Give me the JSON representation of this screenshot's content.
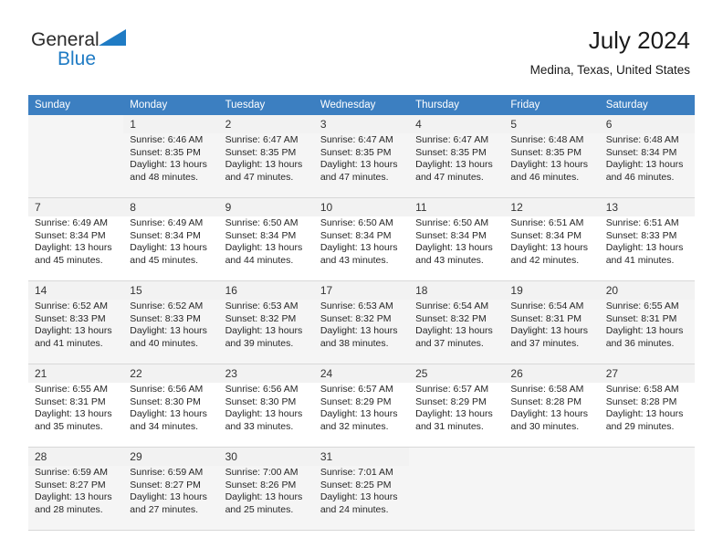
{
  "brand": {
    "name_part1": "General",
    "name_part2": "Blue",
    "color_dark": "#2b2b2b",
    "color_blue": "#1f7bc4"
  },
  "header": {
    "title": "July 2024",
    "subtitle": "Medina, Texas, United States"
  },
  "calendar": {
    "header_bg": "#3c7fc1",
    "weekdays": [
      "Sunday",
      "Monday",
      "Tuesday",
      "Wednesday",
      "Thursday",
      "Friday",
      "Saturday"
    ],
    "labels": {
      "sunrise": "Sunrise:",
      "sunset": "Sunset:",
      "daylight": "Daylight:"
    },
    "weeks": [
      {
        "shaded": true,
        "days": [
          {
            "num": "",
            "sunrise": "",
            "sunset": "",
            "daylight_line1": "",
            "daylight_line2": ""
          },
          {
            "num": "1",
            "sunrise": "Sunrise: 6:46 AM",
            "sunset": "Sunset: 8:35 PM",
            "daylight_line1": "Daylight: 13 hours",
            "daylight_line2": "and 48 minutes."
          },
          {
            "num": "2",
            "sunrise": "Sunrise: 6:47 AM",
            "sunset": "Sunset: 8:35 PM",
            "daylight_line1": "Daylight: 13 hours",
            "daylight_line2": "and 47 minutes."
          },
          {
            "num": "3",
            "sunrise": "Sunrise: 6:47 AM",
            "sunset": "Sunset: 8:35 PM",
            "daylight_line1": "Daylight: 13 hours",
            "daylight_line2": "and 47 minutes."
          },
          {
            "num": "4",
            "sunrise": "Sunrise: 6:47 AM",
            "sunset": "Sunset: 8:35 PM",
            "daylight_line1": "Daylight: 13 hours",
            "daylight_line2": "and 47 minutes."
          },
          {
            "num": "5",
            "sunrise": "Sunrise: 6:48 AM",
            "sunset": "Sunset: 8:35 PM",
            "daylight_line1": "Daylight: 13 hours",
            "daylight_line2": "and 46 minutes."
          },
          {
            "num": "6",
            "sunrise": "Sunrise: 6:48 AM",
            "sunset": "Sunset: 8:34 PM",
            "daylight_line1": "Daylight: 13 hours",
            "daylight_line2": "and 46 minutes."
          }
        ]
      },
      {
        "shaded": false,
        "days": [
          {
            "num": "7",
            "sunrise": "Sunrise: 6:49 AM",
            "sunset": "Sunset: 8:34 PM",
            "daylight_line1": "Daylight: 13 hours",
            "daylight_line2": "and 45 minutes."
          },
          {
            "num": "8",
            "sunrise": "Sunrise: 6:49 AM",
            "sunset": "Sunset: 8:34 PM",
            "daylight_line1": "Daylight: 13 hours",
            "daylight_line2": "and 45 minutes."
          },
          {
            "num": "9",
            "sunrise": "Sunrise: 6:50 AM",
            "sunset": "Sunset: 8:34 PM",
            "daylight_line1": "Daylight: 13 hours",
            "daylight_line2": "and 44 minutes."
          },
          {
            "num": "10",
            "sunrise": "Sunrise: 6:50 AM",
            "sunset": "Sunset: 8:34 PM",
            "daylight_line1": "Daylight: 13 hours",
            "daylight_line2": "and 43 minutes."
          },
          {
            "num": "11",
            "sunrise": "Sunrise: 6:50 AM",
            "sunset": "Sunset: 8:34 PM",
            "daylight_line1": "Daylight: 13 hours",
            "daylight_line2": "and 43 minutes."
          },
          {
            "num": "12",
            "sunrise": "Sunrise: 6:51 AM",
            "sunset": "Sunset: 8:34 PM",
            "daylight_line1": "Daylight: 13 hours",
            "daylight_line2": "and 42 minutes."
          },
          {
            "num": "13",
            "sunrise": "Sunrise: 6:51 AM",
            "sunset": "Sunset: 8:33 PM",
            "daylight_line1": "Daylight: 13 hours",
            "daylight_line2": "and 41 minutes."
          }
        ]
      },
      {
        "shaded": true,
        "days": [
          {
            "num": "14",
            "sunrise": "Sunrise: 6:52 AM",
            "sunset": "Sunset: 8:33 PM",
            "daylight_line1": "Daylight: 13 hours",
            "daylight_line2": "and 41 minutes."
          },
          {
            "num": "15",
            "sunrise": "Sunrise: 6:52 AM",
            "sunset": "Sunset: 8:33 PM",
            "daylight_line1": "Daylight: 13 hours",
            "daylight_line2": "and 40 minutes."
          },
          {
            "num": "16",
            "sunrise": "Sunrise: 6:53 AM",
            "sunset": "Sunset: 8:32 PM",
            "daylight_line1": "Daylight: 13 hours",
            "daylight_line2": "and 39 minutes."
          },
          {
            "num": "17",
            "sunrise": "Sunrise: 6:53 AM",
            "sunset": "Sunset: 8:32 PM",
            "daylight_line1": "Daylight: 13 hours",
            "daylight_line2": "and 38 minutes."
          },
          {
            "num": "18",
            "sunrise": "Sunrise: 6:54 AM",
            "sunset": "Sunset: 8:32 PM",
            "daylight_line1": "Daylight: 13 hours",
            "daylight_line2": "and 37 minutes."
          },
          {
            "num": "19",
            "sunrise": "Sunrise: 6:54 AM",
            "sunset": "Sunset: 8:31 PM",
            "daylight_line1": "Daylight: 13 hours",
            "daylight_line2": "and 37 minutes."
          },
          {
            "num": "20",
            "sunrise": "Sunrise: 6:55 AM",
            "sunset": "Sunset: 8:31 PM",
            "daylight_line1": "Daylight: 13 hours",
            "daylight_line2": "and 36 minutes."
          }
        ]
      },
      {
        "shaded": false,
        "days": [
          {
            "num": "21",
            "sunrise": "Sunrise: 6:55 AM",
            "sunset": "Sunset: 8:31 PM",
            "daylight_line1": "Daylight: 13 hours",
            "daylight_line2": "and 35 minutes."
          },
          {
            "num": "22",
            "sunrise": "Sunrise: 6:56 AM",
            "sunset": "Sunset: 8:30 PM",
            "daylight_line1": "Daylight: 13 hours",
            "daylight_line2": "and 34 minutes."
          },
          {
            "num": "23",
            "sunrise": "Sunrise: 6:56 AM",
            "sunset": "Sunset: 8:30 PM",
            "daylight_line1": "Daylight: 13 hours",
            "daylight_line2": "and 33 minutes."
          },
          {
            "num": "24",
            "sunrise": "Sunrise: 6:57 AM",
            "sunset": "Sunset: 8:29 PM",
            "daylight_line1": "Daylight: 13 hours",
            "daylight_line2": "and 32 minutes."
          },
          {
            "num": "25",
            "sunrise": "Sunrise: 6:57 AM",
            "sunset": "Sunset: 8:29 PM",
            "daylight_line1": "Daylight: 13 hours",
            "daylight_line2": "and 31 minutes."
          },
          {
            "num": "26",
            "sunrise": "Sunrise: 6:58 AM",
            "sunset": "Sunset: 8:28 PM",
            "daylight_line1": "Daylight: 13 hours",
            "daylight_line2": "and 30 minutes."
          },
          {
            "num": "27",
            "sunrise": "Sunrise: 6:58 AM",
            "sunset": "Sunset: 8:28 PM",
            "daylight_line1": "Daylight: 13 hours",
            "daylight_line2": "and 29 minutes."
          }
        ]
      },
      {
        "shaded": true,
        "days": [
          {
            "num": "28",
            "sunrise": "Sunrise: 6:59 AM",
            "sunset": "Sunset: 8:27 PM",
            "daylight_line1": "Daylight: 13 hours",
            "daylight_line2": "and 28 minutes."
          },
          {
            "num": "29",
            "sunrise": "Sunrise: 6:59 AM",
            "sunset": "Sunset: 8:27 PM",
            "daylight_line1": "Daylight: 13 hours",
            "daylight_line2": "and 27 minutes."
          },
          {
            "num": "30",
            "sunrise": "Sunrise: 7:00 AM",
            "sunset": "Sunset: 8:26 PM",
            "daylight_line1": "Daylight: 13 hours",
            "daylight_line2": "and 25 minutes."
          },
          {
            "num": "31",
            "sunrise": "Sunrise: 7:01 AM",
            "sunset": "Sunset: 8:25 PM",
            "daylight_line1": "Daylight: 13 hours",
            "daylight_line2": "and 24 minutes."
          },
          {
            "num": "",
            "sunrise": "",
            "sunset": "",
            "daylight_line1": "",
            "daylight_line2": ""
          },
          {
            "num": "",
            "sunrise": "",
            "sunset": "",
            "daylight_line1": "",
            "daylight_line2": ""
          },
          {
            "num": "",
            "sunrise": "",
            "sunset": "",
            "daylight_line1": "",
            "daylight_line2": ""
          }
        ]
      }
    ]
  }
}
